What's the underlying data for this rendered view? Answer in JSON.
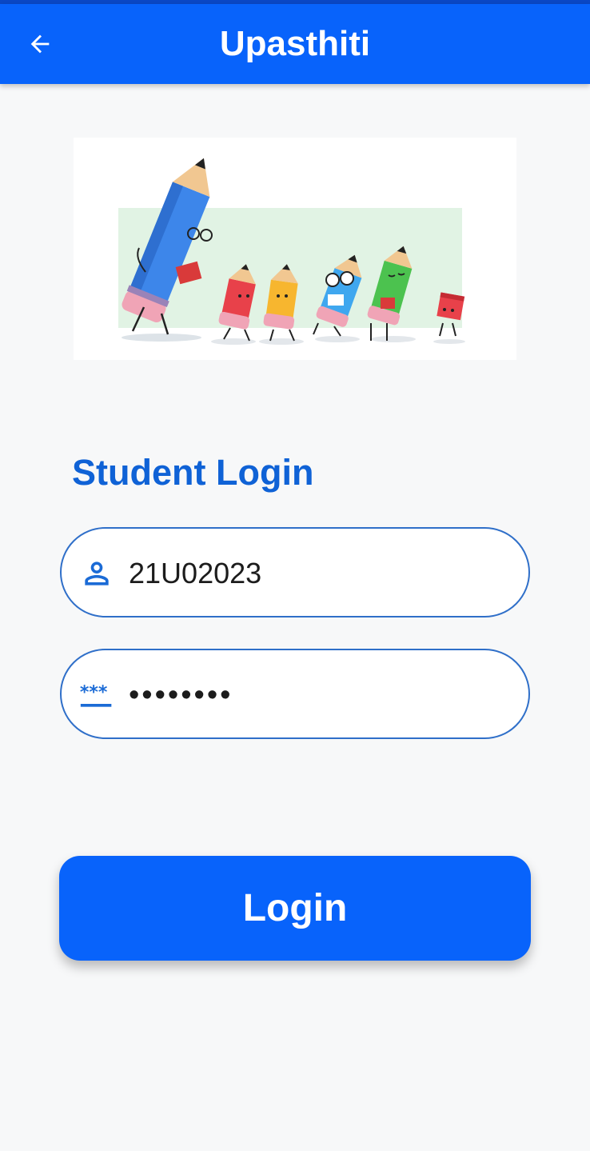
{
  "app_bar": {
    "title": "Upasthiti",
    "back_icon": "arrow-back-icon"
  },
  "hero": {
    "description_icon": "pencils-illustration"
  },
  "login_form": {
    "heading": "Student Login",
    "username": {
      "value": "21U02023",
      "icon": "person-icon"
    },
    "password": {
      "value": "••••••••",
      "icon": "password-icon"
    },
    "submit_label": "Login"
  },
  "colors": {
    "primary": "#0863fb",
    "heading": "#0f62d6",
    "field_border": "#2f6fc9",
    "background": "#f7f8f9"
  }
}
